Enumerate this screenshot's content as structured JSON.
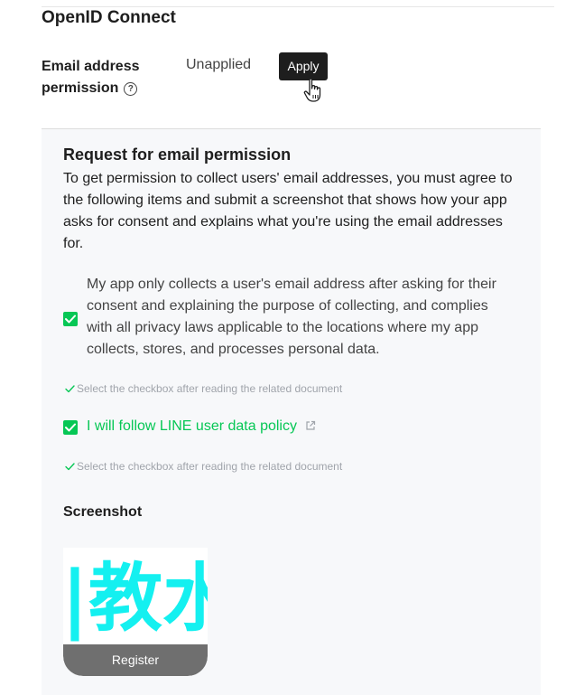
{
  "section": {
    "title": "OpenID Connect"
  },
  "permission": {
    "label_line1": "Email address",
    "label_line2": "permission",
    "help_icon": "question-circle-icon",
    "status": "Unapplied",
    "apply_label": "Apply"
  },
  "request": {
    "title": "Request for email permission",
    "description": "To get permission to collect users' email addresses, you must agree to the following items and submit a screenshot that shows how your app asks for consent and explains what you're using the email addresses for.",
    "consent_checkbox": {
      "checked": true,
      "text": "My app only collects a user's email address after asking for their consent and explaining the purpose of collecting, and complies with all privacy laws applicable to the locations where my app collects, stores, and processes personal data."
    },
    "hint_1": "Select the checkbox after reading the related document",
    "policy_checkbox": {
      "checked": true,
      "link_text": "I will follow LINE user data policy"
    },
    "hint_2": "Select the checkbox after reading the related document",
    "screenshot_label": "Screenshot",
    "thumbnail_text": "|教水",
    "register_label": "Register"
  },
  "colors": {
    "accent_green": "#06c755",
    "apply_bg": "#1e1e1e",
    "panel_bg": "#f7f8fa",
    "hint_gray": "#a0a4ab",
    "thumb_cyan": "#14f0f0"
  }
}
